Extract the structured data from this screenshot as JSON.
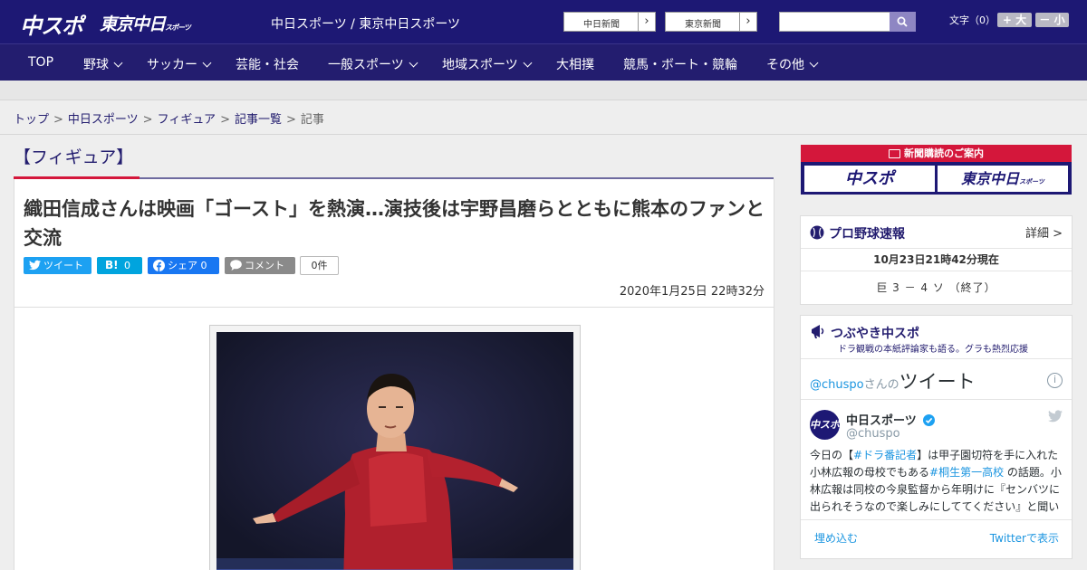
{
  "header": {
    "logo_chuspo": "中スポ",
    "logo_tokyo": "東京中日",
    "logo_tokyo_small": "スポーツ",
    "site_names": "中日スポーツ / 東京中日スポーツ",
    "paper_links": [
      "中日新聞",
      "東京新聞"
    ],
    "search_placeholder": "",
    "font_size_label": "文字（0）",
    "font_bigger": "+ 大",
    "font_smaller": "－ 小"
  },
  "nav": {
    "items": [
      {
        "label": "TOP"
      },
      {
        "label": "野球"
      },
      {
        "label": "サッカー"
      },
      {
        "label": "芸能・社会"
      },
      {
        "label": "一般スポーツ"
      },
      {
        "label": "地域スポーツ"
      },
      {
        "label": "大相撲"
      },
      {
        "label": "競馬・ボート・競輪"
      },
      {
        "label": "その他"
      }
    ]
  },
  "breadcrumb": {
    "items": [
      "トップ",
      "中日スポーツ",
      "フィギュア",
      "記事一覧"
    ],
    "separator": ">",
    "current": "記事"
  },
  "article": {
    "category": "【フィギュア】",
    "headline": "織田信成さんは映画「ゴースト」を熱演…演技後は宇野昌磨らとともに熊本のファンと交流",
    "share": {
      "tweet": "ツイート",
      "hatena": "0",
      "facebook": "シェア 0",
      "comment": "コメント",
      "comment_count": "0件"
    },
    "date": "2020年1月25日 22時32分"
  },
  "sidebar": {
    "subscribe": {
      "title": "新聞購読のご案内",
      "logos": [
        "中スポ",
        "東京中日"
      ],
      "logo_small": "スポーツ"
    },
    "baseball": {
      "title": "プロ野球速報",
      "detail": "詳細 >",
      "time": "10月23日21時42分現在",
      "score": "巨 3 － 4 ソ （終了）"
    },
    "twitter": {
      "title": "つぶやき中スポ",
      "subtitle": "ドラ観戦の本紙評論家も語る。グラも熱烈応援",
      "header_handle": "@chuspo",
      "header_san": "さんの",
      "header_tweet": "ツイート",
      "info": "i",
      "name": "中日スポーツ",
      "handle": "@chuspo",
      "text_parts": [
        "今日の【",
        "#ドラ番記者",
        "】は甲子園切符を手に入れた小林広報の母校でもある",
        "#桐生第一高校",
        " の話題。小林広報は同校の今泉監督から年明けに『センバツに出られそうなので楽しみにしててください』と聞い"
      ],
      "embed": "埋め込む",
      "view_on": "Twitterで表示"
    }
  },
  "colors": {
    "brand_navy": "#1d1874",
    "nav_bg": "#231d6f",
    "accent_red": "#d4173b",
    "twitter_blue": "#1da1f2",
    "hatena_blue": "#00a4de",
    "facebook_blue": "#1877f2",
    "comment_gray": "#8a8a8a"
  }
}
